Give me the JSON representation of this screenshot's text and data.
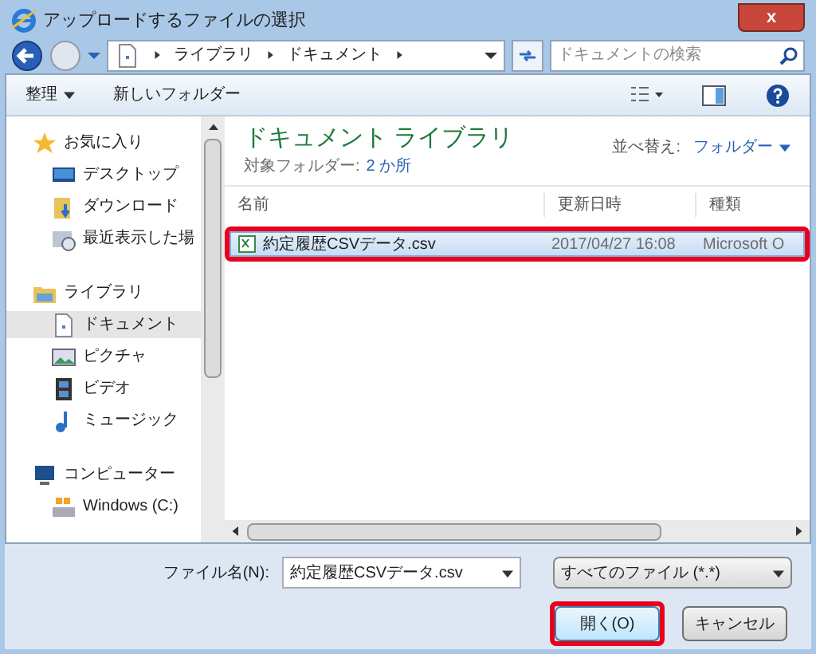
{
  "window": {
    "title": "アップロードするファイルの選択",
    "close": "x"
  },
  "address_bar": {
    "crumbs": [
      "ライブラリ",
      "ドキュメント"
    ]
  },
  "search": {
    "placeholder": "ドキュメントの検索"
  },
  "toolbar": {
    "organize": "整理",
    "new_folder": "新しいフォルダー"
  },
  "sidebar": {
    "groups": [
      {
        "label": "お気に入り",
        "kind": "star",
        "selected": false,
        "children": [
          {
            "label": "デスクトップ",
            "kind": "desktop",
            "selected": false
          },
          {
            "label": "ダウンロード",
            "kind": "download",
            "selected": false
          },
          {
            "label": "最近表示した場",
            "kind": "recent",
            "selected": false
          }
        ]
      },
      {
        "label": "ライブラリ",
        "kind": "library",
        "selected": false,
        "children": [
          {
            "label": "ドキュメント",
            "kind": "document",
            "selected": true
          },
          {
            "label": "ピクチャ",
            "kind": "picture",
            "selected": false
          },
          {
            "label": "ビデオ",
            "kind": "video",
            "selected": false
          },
          {
            "label": "ミュージック",
            "kind": "music",
            "selected": false
          }
        ]
      },
      {
        "label": "コンピューター",
        "kind": "computer",
        "selected": false,
        "children": [
          {
            "label": "Windows (C:)",
            "kind": "drive",
            "selected": false
          }
        ]
      }
    ]
  },
  "library": {
    "title": "ドキュメント ライブラリ",
    "subtitle_label": "対象フォルダー:",
    "subtitle_link": "2 か所",
    "sort_label": "並べ替え:",
    "sort_value": "フォルダー"
  },
  "table": {
    "columns": [
      "名前",
      "更新日時",
      "種類"
    ],
    "rows": [
      {
        "name": "約定履歴CSVデータ.csv",
        "modified": "2017/04/27 16:08",
        "type": "Microsoft O",
        "selected": true,
        "highlighted": true
      }
    ]
  },
  "file_name": {
    "label": "ファイル名(N):",
    "value": "約定履歴CSVデータ.csv"
  },
  "file_type": {
    "value": "すべてのファイル (*.*)"
  },
  "buttons": [
    {
      "label": "開く(O)",
      "kind": "primary",
      "highlighted": true
    },
    {
      "label": "キャンセル",
      "kind": "secondary",
      "highlighted": false
    }
  ]
}
